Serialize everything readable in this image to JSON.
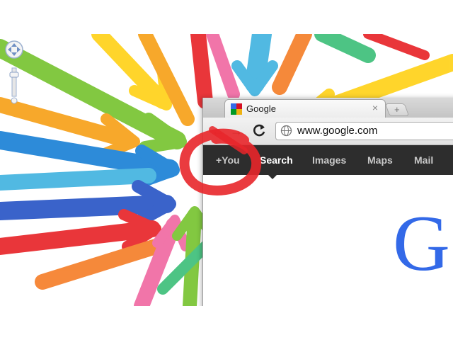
{
  "browser": {
    "tab": {
      "title": "Google",
      "close": "×",
      "favicon": "google-favicon-icon"
    },
    "new_tab": "+",
    "toolbar": {
      "back": "back-arrow-icon",
      "forward": "forward-arrow-icon",
      "reload": "reload-icon",
      "url": "www.google.com"
    },
    "gbar": {
      "items": [
        "+You",
        "Search",
        "Images",
        "Maps",
        "Mail"
      ],
      "active": "Search"
    },
    "logo": {
      "letter": "G",
      "color": "#3369e8"
    }
  },
  "map_controls": {
    "pan": "pan-icon",
    "zoom": "zoom-slider-icon"
  },
  "colors": {
    "accent_red": "#e8262a",
    "bar_bg": "#2d2d2d",
    "arrows": [
      "#78c431",
      "#f7a11a",
      "#1c82d6",
      "#e8262a",
      "#ffd21a",
      "#43b4e0",
      "#f06aa2",
      "#2a56c6",
      "#3ec07a"
    ]
  }
}
